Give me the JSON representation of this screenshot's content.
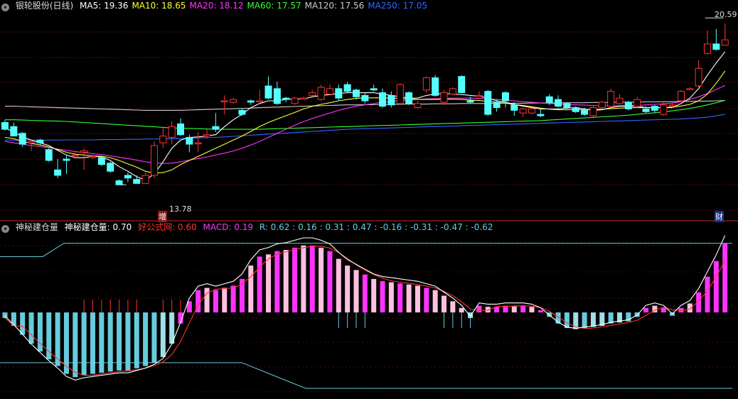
{
  "top_header": {
    "title": "银轮股份(日线)",
    "ma": [
      {
        "label": "MA5: 19.36",
        "color": "#ffffff"
      },
      {
        "label": "MA10: 18.65",
        "color": "#ffff33"
      },
      {
        "label": "MA20: 18.12",
        "color": "#ff33ff"
      },
      {
        "label": "MA60: 17.57",
        "color": "#33ff33"
      },
      {
        "label": "MA120: 17.56",
        "color": "#cccccc"
      },
      {
        "label": "MA250: 17.05",
        "color": "#3366ff"
      }
    ]
  },
  "bottom_header": {
    "title": "神秘建仓量",
    "value_label": "神秘建仓量: 0.70",
    "src_label": "好公式网: 0.60",
    "macd_label": "MACD: 0.19",
    "r_label": "R: 0.62 : 0.16 : 0.31 : 0.47 : -0.16 : -0.31 : -0.47 : -0.62"
  },
  "annotations": {
    "high": "20.59",
    "low": "13.78",
    "tag_low": "增",
    "tag_right": "财"
  },
  "colors": {
    "up": "#ff3232",
    "down": "#54ffff",
    "mag": "#ff33ff",
    "pink": "#ffc0e0",
    "cyan": "#66ccdd",
    "cyan2": "#9fe0e8",
    "grid": "#8b1a1a"
  },
  "chart_data": [
    {
      "type": "candlestick",
      "title": "银轮股份(日线)",
      "x": [
        1,
        2,
        3,
        4,
        5,
        6,
        7,
        8,
        9,
        10,
        11,
        12,
        13,
        14,
        15,
        16,
        17,
        18,
        19,
        20,
        21,
        22,
        23,
        24,
        25,
        26,
        27,
        28,
        29,
        30,
        31,
        32,
        33,
        34,
        35,
        36,
        37,
        38,
        39,
        40,
        41,
        42,
        43,
        44,
        45,
        46,
        47,
        48,
        49,
        50,
        51,
        52,
        53,
        54,
        55,
        56,
        57,
        58,
        59,
        60,
        61,
        62,
        63,
        64,
        65,
        66,
        67,
        68,
        69,
        70,
        71,
        72,
        73,
        74,
        75,
        76,
        77,
        78,
        79,
        80,
        81,
        82,
        83
      ],
      "open": [
        16.75,
        16.6,
        16.35,
        16.0,
        16.1,
        15.75,
        15.0,
        15.4,
        15.55,
        15.65,
        15.5,
        15.45,
        15.25,
        14.6,
        14.8,
        14.65,
        14.5,
        14.8,
        16.0,
        16.2,
        16.7,
        16.2,
        16.0,
        16.25,
        16.6,
        17.55,
        17.5,
        17.2,
        17.55,
        17.55,
        18.1,
        18.0,
        17.65,
        17.45,
        17.65,
        17.75,
        17.6,
        17.8,
        18.0,
        18.15,
        17.95,
        17.75,
        18.0,
        17.85,
        17.75,
        17.45,
        17.85,
        17.3,
        17.95,
        18.4,
        17.5,
        17.8,
        18.45,
        17.55,
        17.75,
        17.9,
        17.5,
        17.85,
        17.4,
        17.1,
        17.1,
        17.05,
        17.7,
        17.6,
        17.45,
        17.3,
        17.2,
        17.0,
        17.3,
        17.35,
        17.45,
        17.5,
        17.35,
        17.25,
        17.35,
        17.05,
        17.4,
        17.55,
        18.0,
        18.1,
        19.3,
        19.65,
        19.6
      ],
      "close": [
        16.5,
        16.25,
        15.95,
        16.05,
        16.0,
        15.35,
        14.8,
        15.35,
        15.55,
        15.7,
        15.5,
        15.2,
        14.95,
        14.45,
        14.7,
        14.5,
        14.8,
        15.9,
        16.25,
        16.6,
        16.3,
        15.95,
        16.0,
        16.3,
        16.5,
        17.55,
        17.6,
        17.05,
        17.5,
        17.55,
        17.65,
        17.45,
        17.6,
        17.65,
        17.65,
        17.85,
        18.05,
        18.0,
        17.65,
        17.9,
        17.7,
        17.55,
        17.95,
        17.35,
        17.4,
        18.15,
        17.45,
        17.45,
        18.4,
        17.75,
        17.85,
        18.0,
        17.85,
        17.5,
        17.75,
        17.05,
        17.3,
        17.55,
        17.2,
        17.25,
        17.25,
        17.0,
        17.5,
        17.35,
        17.3,
        17.15,
        17.05,
        17.3,
        17.5,
        17.9,
        17.65,
        17.25,
        17.6,
        17.15,
        17.2,
        17.4,
        17.4,
        17.9,
        18.0,
        18.75,
        19.65,
        19.45,
        19.8
      ],
      "high": [
        16.85,
        16.75,
        16.4,
        16.1,
        16.15,
        15.8,
        15.4,
        15.55,
        15.7,
        15.8,
        15.55,
        15.5,
        15.3,
        14.65,
        14.9,
        14.8,
        14.9,
        16.05,
        16.55,
        16.8,
        16.9,
        16.3,
        16.4,
        16.5,
        17.1,
        17.75,
        17.65,
        17.25,
        17.6,
        17.95,
        18.45,
        18.25,
        17.7,
        17.7,
        17.7,
        17.95,
        18.15,
        18.15,
        18.15,
        18.25,
        18.0,
        17.85,
        18.15,
        18.0,
        17.9,
        18.2,
        17.9,
        17.55,
        18.45,
        18.5,
        17.95,
        18.05,
        18.5,
        17.7,
        17.9,
        17.95,
        17.6,
        17.9,
        17.5,
        17.3,
        17.3,
        17.25,
        17.8,
        17.75,
        17.5,
        17.35,
        17.3,
        17.4,
        17.55,
        18.0,
        17.8,
        17.55,
        17.7,
        17.35,
        17.4,
        17.5,
        17.45,
        17.95,
        18.05,
        19.05,
        20.15,
        20.2,
        20.4
      ],
      "low": [
        16.45,
        16.25,
        15.85,
        15.7,
        15.9,
        15.3,
        14.7,
        14.85,
        15.45,
        15.0,
        15.4,
        15.15,
        14.9,
        14.45,
        14.55,
        14.5,
        14.5,
        14.7,
        15.8,
        15.95,
        16.25,
        15.65,
        15.65,
        16.15,
        16.4,
        17.05,
        17.45,
        17.0,
        17.4,
        17.5,
        17.6,
        17.4,
        17.5,
        17.4,
        17.6,
        17.7,
        17.55,
        17.75,
        17.55,
        17.85,
        17.6,
        17.45,
        17.9,
        17.3,
        17.3,
        17.4,
        17.4,
        17.25,
        17.85,
        17.7,
        17.4,
        17.75,
        17.85,
        17.45,
        17.7,
        17.0,
        17.15,
        17.3,
        17.0,
        16.95,
        17.05,
        16.95,
        17.4,
        17.3,
        17.25,
        17.1,
        17.0,
        16.95,
        17.3,
        17.3,
        17.4,
        17.2,
        17.3,
        17.1,
        17.1,
        17.0,
        17.3,
        17.5,
        17.95,
        18.05,
        19.25,
        19.4,
        19.6
      ],
      "ma5": [
        16.55,
        16.4,
        16.22,
        16.1,
        16.0,
        15.9,
        15.72,
        15.55,
        15.45,
        15.45,
        15.5,
        15.48,
        15.35,
        15.12,
        14.95,
        14.75,
        14.62,
        14.85,
        15.3,
        15.8,
        16.1,
        16.2,
        16.22,
        16.25,
        16.3,
        16.6,
        16.85,
        17.05,
        17.3,
        17.45,
        17.55,
        17.55,
        17.6,
        17.62,
        17.62,
        17.7,
        17.75,
        17.78,
        17.82,
        17.85,
        17.85,
        17.85,
        17.85,
        17.8,
        17.75,
        17.7,
        17.65,
        17.65,
        17.75,
        17.8,
        17.82,
        17.8,
        17.78,
        17.75,
        17.72,
        17.65,
        17.55,
        17.5,
        17.42,
        17.35,
        17.3,
        17.25,
        17.25,
        17.25,
        17.28,
        17.3,
        17.25,
        17.2,
        17.22,
        17.3,
        17.35,
        17.35,
        17.35,
        17.3,
        17.3,
        17.3,
        17.3,
        17.45,
        17.65,
        18.0,
        18.5,
        18.95,
        19.36
      ],
      "ma10": [
        16.2,
        16.15,
        16.05,
        15.98,
        15.92,
        15.85,
        15.75,
        15.65,
        15.58,
        15.55,
        15.52,
        15.5,
        15.45,
        15.35,
        15.22,
        15.1,
        14.95,
        14.88,
        14.9,
        15.0,
        15.2,
        15.35,
        15.5,
        15.65,
        15.8,
        15.95,
        16.1,
        16.25,
        16.42,
        16.6,
        16.75,
        16.88,
        17.0,
        17.12,
        17.25,
        17.35,
        17.42,
        17.48,
        17.55,
        17.6,
        17.64,
        17.66,
        17.66,
        17.66,
        17.65,
        17.64,
        17.62,
        17.6,
        17.6,
        17.6,
        17.61,
        17.61,
        17.6,
        17.58,
        17.56,
        17.53,
        17.5,
        17.46,
        17.42,
        17.38,
        17.33,
        17.28,
        17.24,
        17.22,
        17.22,
        17.22,
        17.23,
        17.23,
        17.24,
        17.26,
        17.28,
        17.3,
        17.3,
        17.3,
        17.3,
        17.3,
        17.32,
        17.36,
        17.42,
        17.55,
        17.8,
        18.2,
        18.65
      ],
      "ma20": [
        16.05,
        16.0,
        15.95,
        15.9,
        15.86,
        15.82,
        15.77,
        15.72,
        15.68,
        15.64,
        15.6,
        15.56,
        15.52,
        15.47,
        15.42,
        15.36,
        15.3,
        15.26,
        15.24,
        15.25,
        15.3,
        15.36,
        15.42,
        15.48,
        15.55,
        15.62,
        15.7,
        15.8,
        15.92,
        16.05,
        16.2,
        16.35,
        16.5,
        16.65,
        16.78,
        16.9,
        17.0,
        17.1,
        17.2,
        17.28,
        17.35,
        17.4,
        17.45,
        17.5,
        17.53,
        17.56,
        17.58,
        17.6,
        17.62,
        17.63,
        17.64,
        17.65,
        17.65,
        17.65,
        17.64,
        17.62,
        17.6,
        17.58,
        17.55,
        17.52,
        17.5,
        17.47,
        17.45,
        17.43,
        17.41,
        17.4,
        17.39,
        17.38,
        17.37,
        17.37,
        17.37,
        17.38,
        17.38,
        17.4,
        17.42,
        17.44,
        17.47,
        17.52,
        17.6,
        17.7,
        17.82,
        17.97,
        18.12
      ],
      "ma60": [
        16.85,
        16.85,
        16.84,
        16.83,
        16.82,
        16.81,
        16.8,
        16.79,
        16.77,
        16.75,
        16.73,
        16.71,
        16.69,
        16.67,
        16.65,
        16.63,
        16.61,
        16.59,
        16.57,
        16.55,
        16.54,
        16.53,
        16.52,
        16.51,
        16.5,
        16.5,
        16.5,
        16.5,
        16.5,
        16.5,
        16.51,
        16.52,
        16.53,
        16.54,
        16.55,
        16.56,
        16.57,
        16.58,
        16.59,
        16.6,
        16.61,
        16.62,
        16.63,
        16.64,
        16.65,
        16.66,
        16.67,
        16.68,
        16.69,
        16.7,
        16.71,
        16.72,
        16.73,
        16.74,
        16.75,
        16.76,
        16.77,
        16.78,
        16.79,
        16.8,
        16.81,
        16.82,
        16.84,
        16.86,
        16.88,
        16.9,
        16.92,
        16.94,
        16.96,
        16.98,
        17.0,
        17.02,
        17.05,
        17.08,
        17.11,
        17.14,
        17.18,
        17.22,
        17.27,
        17.33,
        17.4,
        17.48,
        17.57
      ],
      "ma120": [
        17.35,
        17.35,
        17.34,
        17.33,
        17.32,
        17.31,
        17.3,
        17.29,
        17.28,
        17.27,
        17.26,
        17.25,
        17.24,
        17.23,
        17.22,
        17.21,
        17.2,
        17.2,
        17.2,
        17.2,
        17.2,
        17.21,
        17.22,
        17.23,
        17.24,
        17.25,
        17.26,
        17.27,
        17.28,
        17.3,
        17.31,
        17.32,
        17.33,
        17.34,
        17.35,
        17.36,
        17.37,
        17.38,
        17.39,
        17.4,
        17.4,
        17.41,
        17.41,
        17.42,
        17.42,
        17.42,
        17.43,
        17.43,
        17.43,
        17.44,
        17.44,
        17.44,
        17.45,
        17.45,
        17.45,
        17.45,
        17.46,
        17.46,
        17.46,
        17.46,
        17.47,
        17.47,
        17.47,
        17.47,
        17.48,
        17.48,
        17.48,
        17.49,
        17.49,
        17.49,
        17.5,
        17.5,
        17.5,
        17.51,
        17.51,
        17.52,
        17.52,
        17.53,
        17.53,
        17.54,
        17.54,
        17.55,
        17.56
      ],
      "ma250": [
        16.1,
        16.1,
        16.1,
        16.1,
        16.1,
        16.1,
        16.1,
        16.11,
        16.11,
        16.11,
        16.11,
        16.12,
        16.12,
        16.12,
        16.13,
        16.13,
        16.14,
        16.14,
        16.15,
        16.15,
        16.16,
        16.17,
        16.18,
        16.19,
        16.2,
        16.22,
        16.24,
        16.26,
        16.28,
        16.3,
        16.32,
        16.34,
        16.36,
        16.38,
        16.4,
        16.42,
        16.44,
        16.46,
        16.48,
        16.5,
        16.51,
        16.52,
        16.53,
        16.54,
        16.55,
        16.56,
        16.57,
        16.58,
        16.59,
        16.6,
        16.61,
        16.62,
        16.63,
        16.64,
        16.65,
        16.66,
        16.67,
        16.68,
        16.69,
        16.7,
        16.71,
        16.72,
        16.73,
        16.74,
        16.75,
        16.76,
        16.77,
        16.78,
        16.79,
        16.8,
        16.81,
        16.82,
        16.83,
        16.84,
        16.85,
        16.86,
        16.87,
        16.88,
        16.9,
        16.92,
        16.95,
        17.0,
        17.05
      ],
      "ylim": [
        13.2,
        20.8
      ]
    },
    {
      "type": "bar",
      "title": "神秘建仓量",
      "x": [
        1,
        2,
        3,
        4,
        5,
        6,
        7,
        8,
        9,
        10,
        11,
        12,
        13,
        14,
        15,
        16,
        17,
        18,
        19,
        20,
        21,
        22,
        23,
        24,
        25,
        26,
        27,
        28,
        29,
        30,
        31,
        32,
        33,
        34,
        35,
        36,
        37,
        38,
        39,
        40,
        41,
        42,
        43,
        44,
        45,
        46,
        47,
        48,
        49,
        50,
        51,
        52,
        53,
        54,
        55,
        56,
        57,
        58,
        59,
        60,
        61,
        62,
        63,
        64,
        65,
        66,
        67,
        68,
        69,
        70,
        71,
        72,
        73,
        74,
        75,
        76,
        77,
        78,
        79,
        80,
        81,
        82,
        83
      ],
      "values": [
        -0.05,
        -0.12,
        -0.2,
        -0.28,
        -0.35,
        -0.42,
        -0.48,
        -0.55,
        -0.58,
        -0.56,
        -0.55,
        -0.54,
        -0.53,
        -0.52,
        -0.52,
        -0.5,
        -0.48,
        -0.45,
        -0.4,
        -0.28,
        -0.1,
        0.1,
        0.2,
        0.22,
        0.2,
        0.22,
        0.24,
        0.3,
        0.42,
        0.5,
        0.52,
        0.55,
        0.56,
        0.58,
        0.6,
        0.6,
        0.58,
        0.55,
        0.48,
        0.42,
        0.38,
        0.34,
        0.3,
        0.28,
        0.27,
        0.26,
        0.25,
        0.24,
        0.22,
        0.2,
        0.15,
        0.1,
        0.04,
        -0.05,
        0.06,
        0.05,
        0.05,
        0.06,
        0.06,
        0.06,
        0.05,
        0.02,
        -0.04,
        -0.1,
        -0.14,
        -0.15,
        -0.14,
        -0.13,
        -0.12,
        -0.1,
        -0.09,
        -0.08,
        -0.04,
        0.04,
        0.06,
        0.04,
        -0.03,
        0.04,
        0.08,
        0.18,
        0.32,
        0.46,
        0.62
      ],
      "colors": [
        "cyan",
        "cyan",
        "cyan",
        "cyan",
        "cyan",
        "cyan",
        "cyan",
        "cyan",
        "cyan",
        "cyan",
        "cyan",
        "cyan",
        "cyan",
        "cyan",
        "cyan",
        "cyan",
        "cyan",
        "cyan",
        "cyan2",
        "cyan2",
        "mag",
        "mag",
        "mag",
        "pink",
        "mag",
        "pink",
        "mag",
        "mag",
        "pink",
        "mag",
        "pink",
        "mag",
        "pink",
        "mag",
        "pink",
        "mag",
        "pink",
        "mag",
        "pink",
        "pink",
        "pink",
        "mag",
        "pink",
        "mag",
        "pink",
        "mag",
        "pink",
        "pink",
        "mag",
        "pink",
        "pink",
        "pink",
        "pink",
        "cyan2",
        "mag",
        "pink",
        "mag",
        "mag",
        "pink",
        "mag",
        "pink",
        "mag",
        "cyan",
        "cyan",
        "cyan",
        "cyan2",
        "cyan",
        "cyan2",
        "cyan2",
        "cyan",
        "cyan2",
        "cyan",
        "cyan",
        "mag",
        "pink",
        "mag",
        "cyan",
        "mag",
        "pink",
        "mag",
        "mag",
        "mag",
        "mag"
      ],
      "levels": [
        0.62,
        0.16,
        0.31,
        0.47,
        -0.16,
        -0.31,
        -0.47,
        -0.62
      ],
      "ylim": [
        -0.75,
        0.7
      ]
    }
  ]
}
